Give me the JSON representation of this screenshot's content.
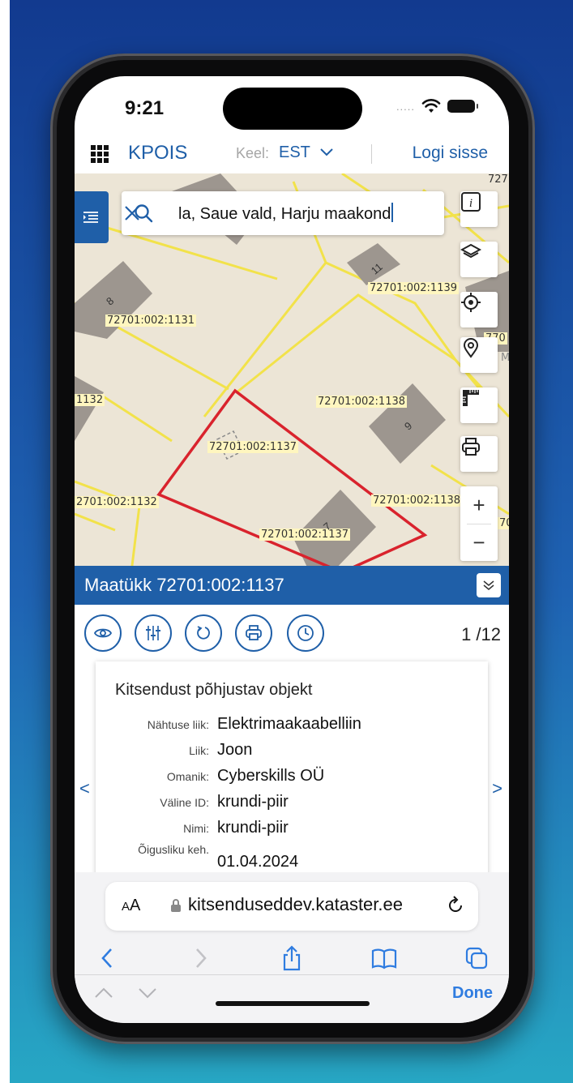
{
  "status_bar": {
    "time": "9:21",
    "signal_dots": "....."
  },
  "header": {
    "menu_icon": "grid-icon",
    "brand": "KPOIS",
    "language_label": "Keel:",
    "language_value": "EST",
    "login": "Logi sisse"
  },
  "map": {
    "search": {
      "value": "la, Saue vald, Harju maakond"
    },
    "parcel_labels": [
      "72701:002:1131",
      "72701:002:1139",
      "1132",
      "72701:002:1138",
      "72701:002:1137",
      "2701:002:1132",
      "72701:002:1138",
      "72701:002:1137"
    ],
    "building_numbers": [
      "8",
      "11",
      "9",
      "7"
    ],
    "edge_fragments": [
      "727",
      "770",
      "Ma",
      "70"
    ],
    "tools": [
      "info-icon",
      "layers-icon",
      "locate-icon",
      "pin-icon",
      "ruler-icon",
      "print-icon"
    ],
    "zoom_in": "+",
    "zoom_out": "−"
  },
  "panel": {
    "title": "Maatükk 72701:002:1137",
    "actions": [
      "eye-icon",
      "filter-sliders-icon",
      "rotate-icon",
      "print-icon",
      "history-clock-icon"
    ],
    "pager": "1 /12",
    "card": {
      "title": "Kitsendust põhjustav objekt",
      "rows": [
        {
          "key": "Nähtuse liik:",
          "value": "Elektrimaakaabelliin"
        },
        {
          "key": "Liik:",
          "value": "Joon"
        },
        {
          "key": "Omanik:",
          "value": "Cyberskills OÜ"
        },
        {
          "key": "Väline ID:",
          "value": "krundi-piir"
        },
        {
          "key": "Nimi:",
          "value": "krundi-piir"
        },
        {
          "key": "Õigusliku keh.",
          "value": "01.04.2024"
        }
      ]
    },
    "prev": "<",
    "next": ">"
  },
  "safari": {
    "aa_small": "A",
    "aa_big": "A",
    "url": "kitsenduseddev.kataster.ee",
    "done": "Done"
  },
  "colors": {
    "brand": "#1f5fa8",
    "parcel_highlight": "#d9232d",
    "parcel_line": "#f4e64a",
    "building": "#9d968f"
  }
}
